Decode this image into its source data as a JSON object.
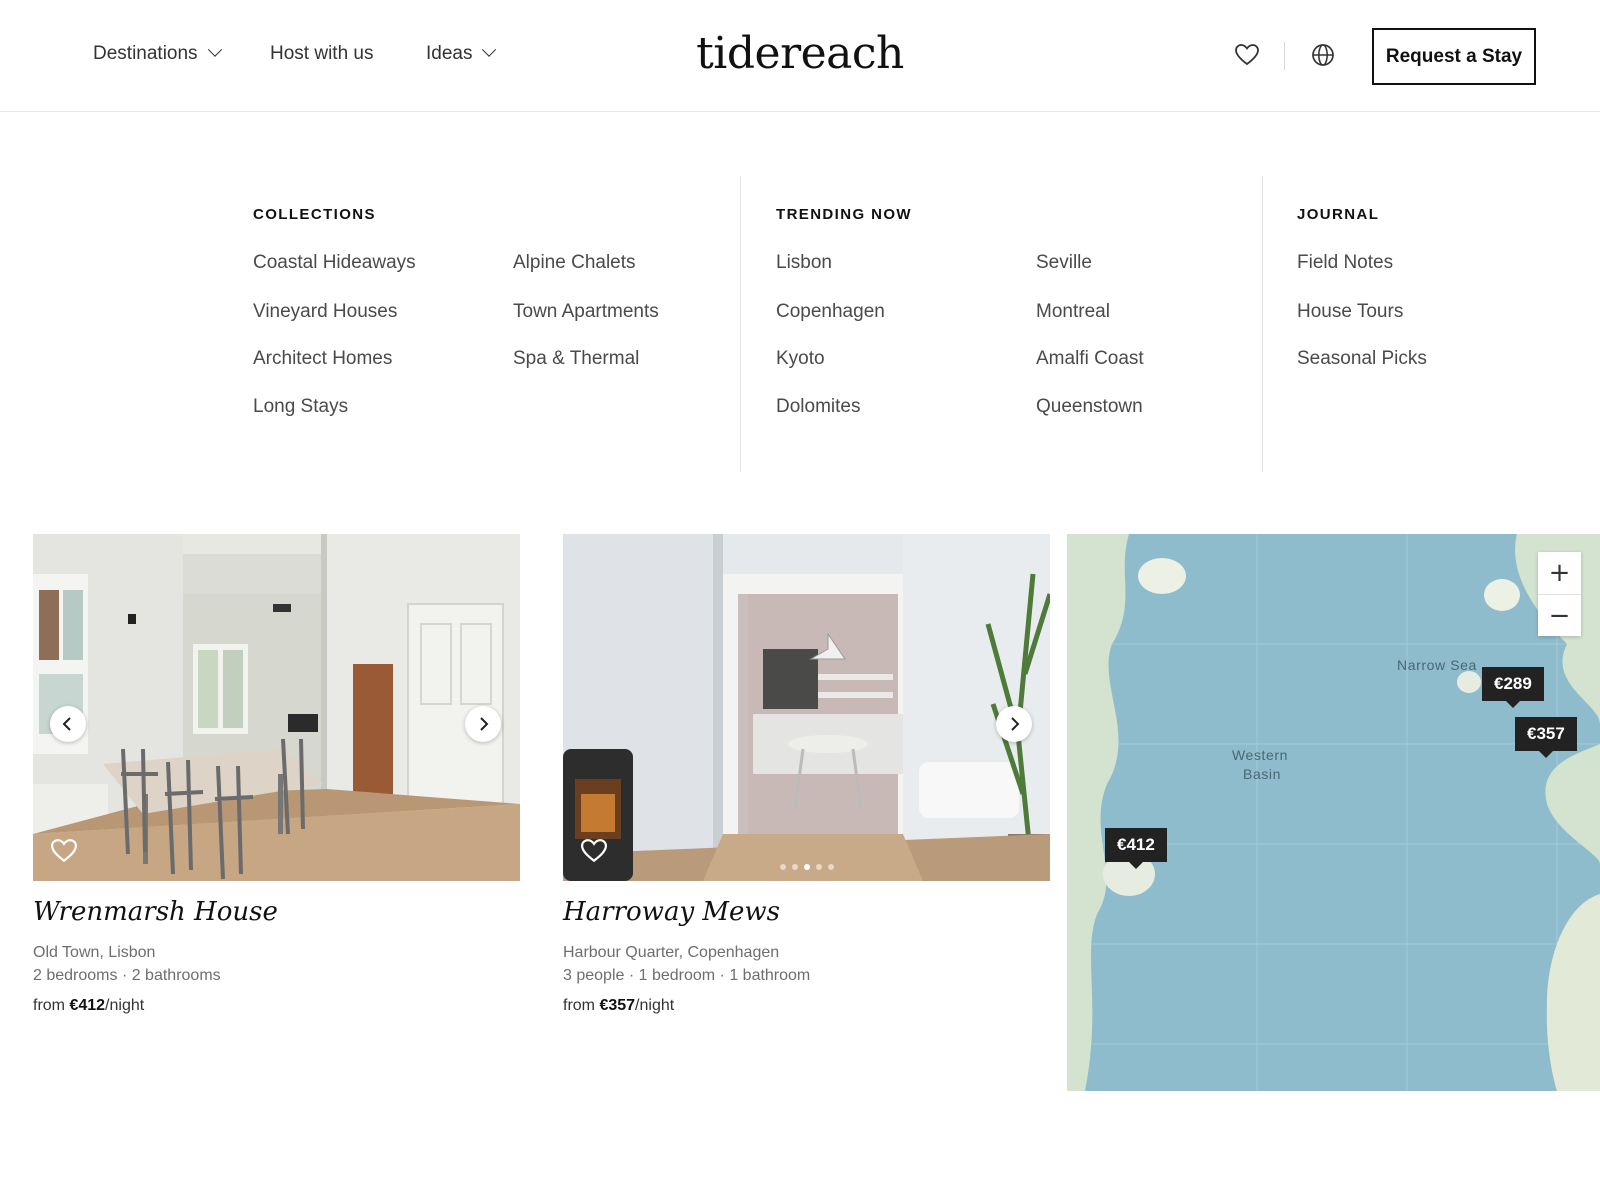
{
  "header": {
    "nav": [
      {
        "label": "Destinations",
        "has_dropdown": true
      },
      {
        "label": "Host with us",
        "has_dropdown": false
      },
      {
        "label": "Ideas",
        "has_dropdown": true
      }
    ],
    "logo": "tidereach",
    "icons": [
      "heart-icon",
      "globe-icon"
    ],
    "cta_label": "Request a Stay"
  },
  "menu": {
    "collections": {
      "heading": "COLLECTIONS",
      "items": [
        "Coastal Hideaways",
        "Alpine Chalets",
        "Vineyard Houses",
        "Town Apartments",
        "Architect Homes",
        "Spa & Thermal",
        "Long Stays"
      ]
    },
    "trending": {
      "heading": "TRENDING NOW",
      "items": [
        "Lisbon",
        "Seville",
        "Copenhagen",
        "Montreal",
        "Kyoto",
        "Amalfi Coast",
        "Dolomites",
        "Queenstown"
      ]
    },
    "journal": {
      "heading": "JOURNAL",
      "items": [
        "Field Notes",
        "House Tours",
        "Seasonal Picks"
      ]
    }
  },
  "listings": [
    {
      "title": "Wrenmarsh House",
      "location": "Old Town, Lisbon",
      "specs": "2 bedrooms · 2 bathrooms",
      "price_prefix": "from",
      "price": "€412",
      "price_suffix": "/night"
    },
    {
      "title": "Harroway Mews",
      "location": "Harbour Quarter, Copenhagen",
      "specs": "3 people · 1 bedroom · 1 bathroom",
      "price_prefix": "from",
      "price": "€357",
      "price_suffix": "/night",
      "photo_count": 5,
      "active_photo": 3
    }
  ],
  "map": {
    "labels": [
      "Narrow Sea",
      "Western",
      "Basin"
    ],
    "pins": [
      "€289",
      "€357",
      "€412"
    ],
    "zoom_in": "+",
    "zoom_out": "−",
    "colors": {
      "water": "#8fbccc",
      "land": "#d3e3cf",
      "pin": "#222222"
    }
  },
  "colors": {
    "text": "#222222",
    "muted": "#6e6e6e",
    "border": "#e6e6e6"
  }
}
